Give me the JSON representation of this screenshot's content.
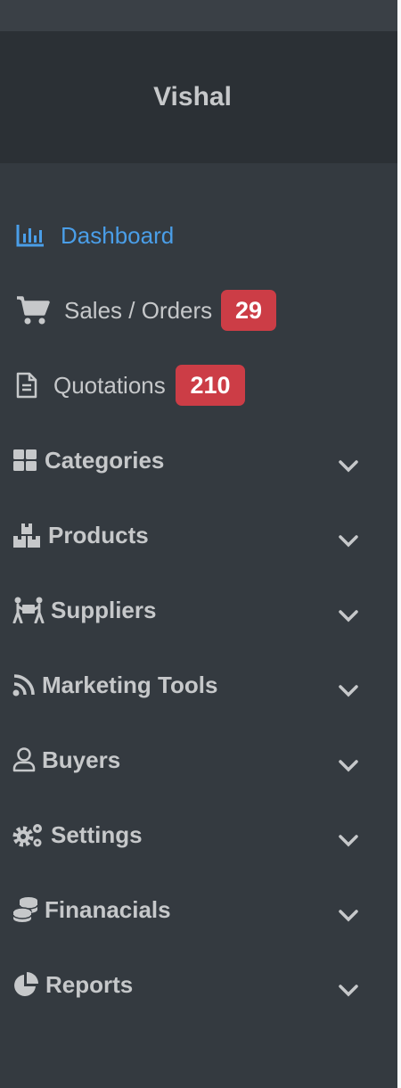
{
  "brand": {
    "name": "Vishal"
  },
  "nav": {
    "dashboard": {
      "label": "Dashboard",
      "icon": "chart-bar-icon"
    },
    "sales": {
      "label": "Sales / Orders",
      "icon": "shopping-cart-icon",
      "badge": "29"
    },
    "quotations": {
      "label": "Quotations",
      "icon": "file-text-icon",
      "badge": "210"
    },
    "categories": {
      "label": "Categories",
      "icon": "th-large-icon"
    },
    "products": {
      "label": "Products",
      "icon": "boxes-icon"
    },
    "suppliers": {
      "label": "Suppliers",
      "icon": "people-carry-icon"
    },
    "marketing": {
      "label": "Marketing Tools",
      "icon": "rss-icon"
    },
    "buyers": {
      "label": "Buyers",
      "icon": "user-icon"
    },
    "settings": {
      "label": "Settings",
      "icon": "cogs-icon"
    },
    "financials": {
      "label": "Finanacials",
      "icon": "coins-icon"
    },
    "reports": {
      "label": "Reports",
      "icon": "chart-pie-icon"
    }
  },
  "colors": {
    "sidebar_bg": "#343a40",
    "brand_bg": "#2b3035",
    "active": "#4a9ee8",
    "text": "#c6c8ca",
    "badge": "#cc3d46"
  }
}
